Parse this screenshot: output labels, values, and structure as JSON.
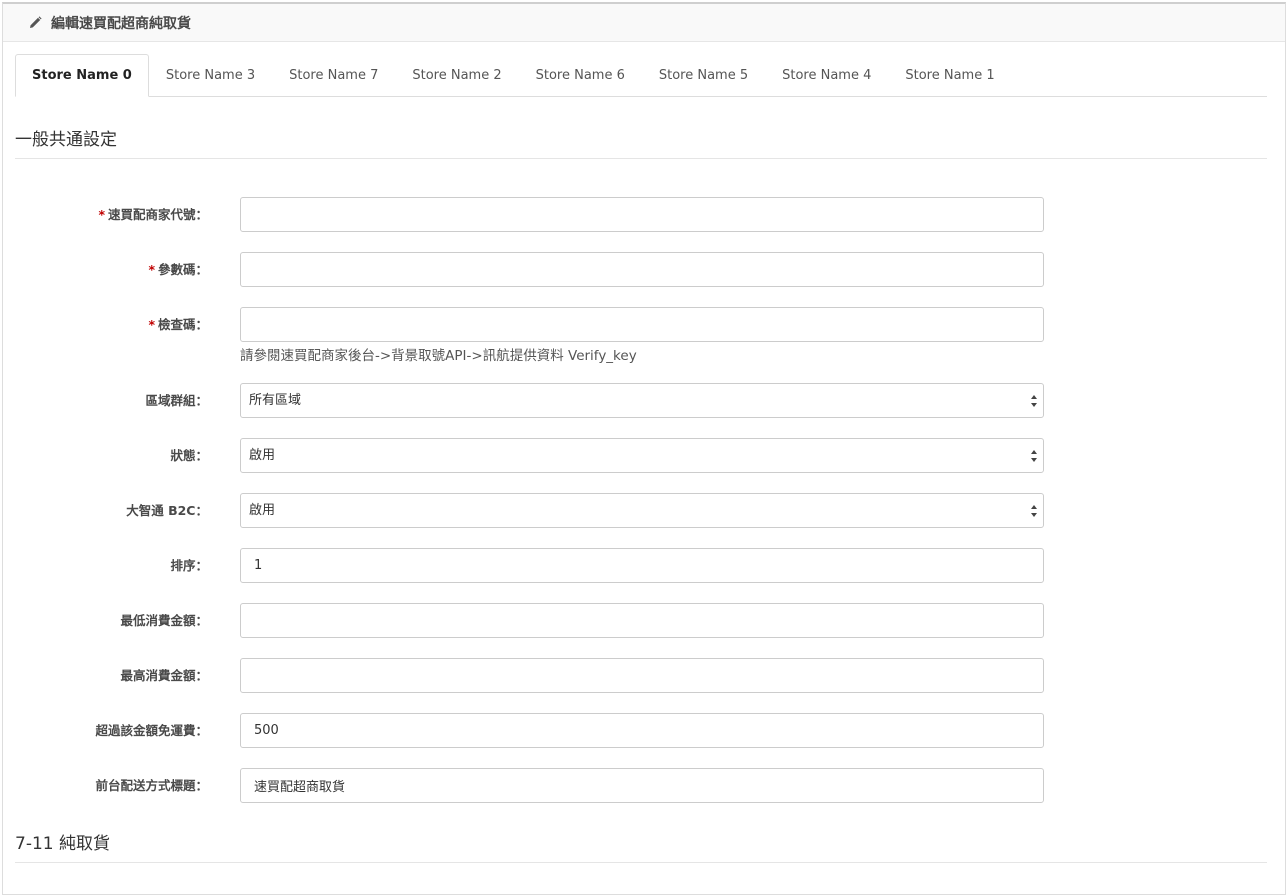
{
  "header": {
    "title": "編輯速買配超商純取貨",
    "icon": "pencil-icon"
  },
  "tabs": [
    {
      "label": "Store Name 0",
      "active": true
    },
    {
      "label": "Store Name 3",
      "active": false
    },
    {
      "label": "Store Name 7",
      "active": false
    },
    {
      "label": "Store Name 2",
      "active": false
    },
    {
      "label": "Store Name 6",
      "active": false
    },
    {
      "label": "Store Name 5",
      "active": false
    },
    {
      "label": "Store Name 4",
      "active": false
    },
    {
      "label": "Store Name 1",
      "active": false
    }
  ],
  "sections": {
    "general": "一般共通設定",
    "seven_eleven": "7-11 純取貨"
  },
  "form": {
    "merchant_id": {
      "label": "速買配商家代號：",
      "required": true,
      "value": ""
    },
    "param_code": {
      "label": "參數碼：",
      "required": true,
      "value": ""
    },
    "check_code": {
      "label": "檢查碼：",
      "required": true,
      "value": "",
      "help": "請參閱速買配商家後台->背景取號API->訊航提供資料 Verify_key"
    },
    "region_group": {
      "label": "區域群組：",
      "selected": "所有區域"
    },
    "status": {
      "label": "狀態：",
      "selected": "啟用"
    },
    "b2c": {
      "label": "大智通 B2C：",
      "selected": "啟用"
    },
    "sort_order": {
      "label": "排序：",
      "value": "1"
    },
    "min_amount": {
      "label": "最低消費金額：",
      "value": ""
    },
    "max_amount": {
      "label": "最高消費金額：",
      "value": ""
    },
    "free_shipping": {
      "label": "超過該金額免運費：",
      "value": "500"
    },
    "frontend_title": {
      "label": "前台配送方式標題：",
      "value": "速買配超商取貨"
    }
  },
  "required_mark": "*",
  "colors": {
    "required": "#c00000",
    "border": "#cccccc",
    "heading_bg": "#f9f9f9"
  }
}
